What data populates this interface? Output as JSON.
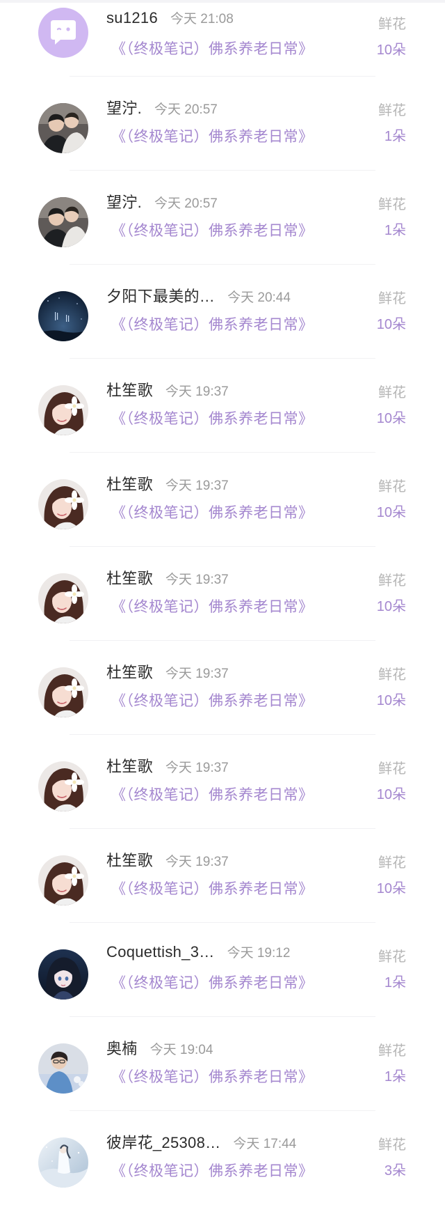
{
  "rows": [
    {
      "username": "su1216",
      "time": "今天 21:08",
      "book": "《（终极笔记）佛系养老日常》",
      "flower_label": "鲜花",
      "flower_count": "10朵",
      "avatar": "chat-bubble-icon"
    },
    {
      "username": "望泞.",
      "time": "今天 20:57",
      "book": "《（终极笔记）佛系养老日常》",
      "flower_label": "鲜花",
      "flower_count": "1朵",
      "avatar": "couple-photo"
    },
    {
      "username": "望泞.",
      "time": "今天 20:57",
      "book": "《（终极笔记）佛系养老日常》",
      "flower_label": "鲜花",
      "flower_count": "1朵",
      "avatar": "couple-photo"
    },
    {
      "username": "夕阳下最美的…",
      "time": "今天 20:44",
      "book": "《（终极笔记）佛系养老日常》",
      "flower_label": "鲜花",
      "flower_count": "10朵",
      "avatar": "night-sky-photo"
    },
    {
      "username": "杜笙歌",
      "time": "今天 19:37",
      "book": "《（终极笔记）佛系养老日常》",
      "flower_label": "鲜花",
      "flower_count": "10朵",
      "avatar": "girl-flower-photo"
    },
    {
      "username": "杜笙歌",
      "time": "今天 19:37",
      "book": "《（终极笔记）佛系养老日常》",
      "flower_label": "鲜花",
      "flower_count": "10朵",
      "avatar": "girl-flower-photo"
    },
    {
      "username": "杜笙歌",
      "time": "今天 19:37",
      "book": "《（终极笔记）佛系养老日常》",
      "flower_label": "鲜花",
      "flower_count": "10朵",
      "avatar": "girl-flower-photo"
    },
    {
      "username": "杜笙歌",
      "time": "今天 19:37",
      "book": "《（终极笔记）佛系养老日常》",
      "flower_label": "鲜花",
      "flower_count": "10朵",
      "avatar": "girl-flower-photo"
    },
    {
      "username": "杜笙歌",
      "time": "今天 19:37",
      "book": "《（终极笔记）佛系养老日常》",
      "flower_label": "鲜花",
      "flower_count": "10朵",
      "avatar": "girl-flower-photo"
    },
    {
      "username": "杜笙歌",
      "time": "今天 19:37",
      "book": "《（终极笔记）佛系养老日常》",
      "flower_label": "鲜花",
      "flower_count": "10朵",
      "avatar": "girl-flower-photo"
    },
    {
      "username": "Coquettish_3…",
      "time": "今天 19:12",
      "book": "《（终极笔记）佛系养老日常》",
      "flower_label": "鲜花",
      "flower_count": "1朵",
      "avatar": "anime-girl-photo"
    },
    {
      "username": "奥楠",
      "time": "今天 19:04",
      "book": "《（终极笔记）佛系养老日常》",
      "flower_label": "鲜花",
      "flower_count": "1朵",
      "avatar": "person-photo"
    },
    {
      "username": "彼岸花_25308…",
      "time": "今天 17:44",
      "book": "《（终极笔记）佛系养老日常》",
      "flower_label": "鲜花",
      "flower_count": "3朵",
      "avatar": "snow-scene-photo"
    }
  ],
  "colors": {
    "accent_purple": "#a487cf",
    "avatar_purple": "#d0b8f2",
    "username_text": "#2b2b2b",
    "muted_text": "#9a9a9a"
  }
}
